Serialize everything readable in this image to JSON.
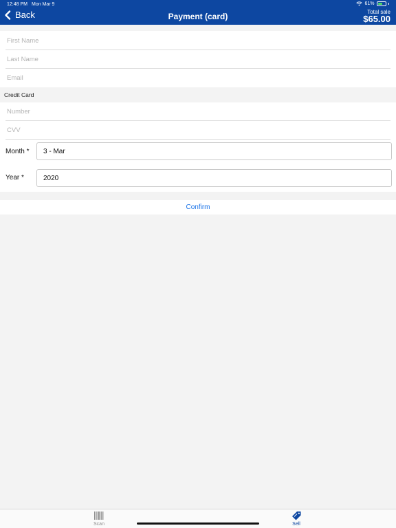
{
  "status_bar": {
    "time": "12:48 PM",
    "date": "Mon Mar 9",
    "battery": "61%",
    "battery_level": 0.61,
    "wifi_icon": "wifi-icon",
    "battery_icon": "battery-icon"
  },
  "header": {
    "back_label": "Back",
    "back_icon": "chevron-left-icon",
    "title": "Payment (card)",
    "total_label": "Total sale",
    "total_amount": "$65.00"
  },
  "customer": {
    "first_name_placeholder": "First Name",
    "last_name_placeholder": "Last Name",
    "email_placeholder": "Email"
  },
  "card": {
    "section_label": "Credit Card",
    "number_placeholder": "Number",
    "cvv_placeholder": "CVV",
    "month_label": "Month *",
    "month_value": "3 - Mar",
    "year_label": "Year *",
    "year_value": "2020"
  },
  "confirm_label": "Confirm",
  "tabbar": {
    "scan_label": "Scan",
    "scan_icon": "barcode-icon",
    "sell_label": "Sell",
    "sell_icon": "tag-icon"
  },
  "colors": {
    "header": "#0d47a1",
    "accent": "#1a73e8",
    "background": "#f3f3f3"
  }
}
